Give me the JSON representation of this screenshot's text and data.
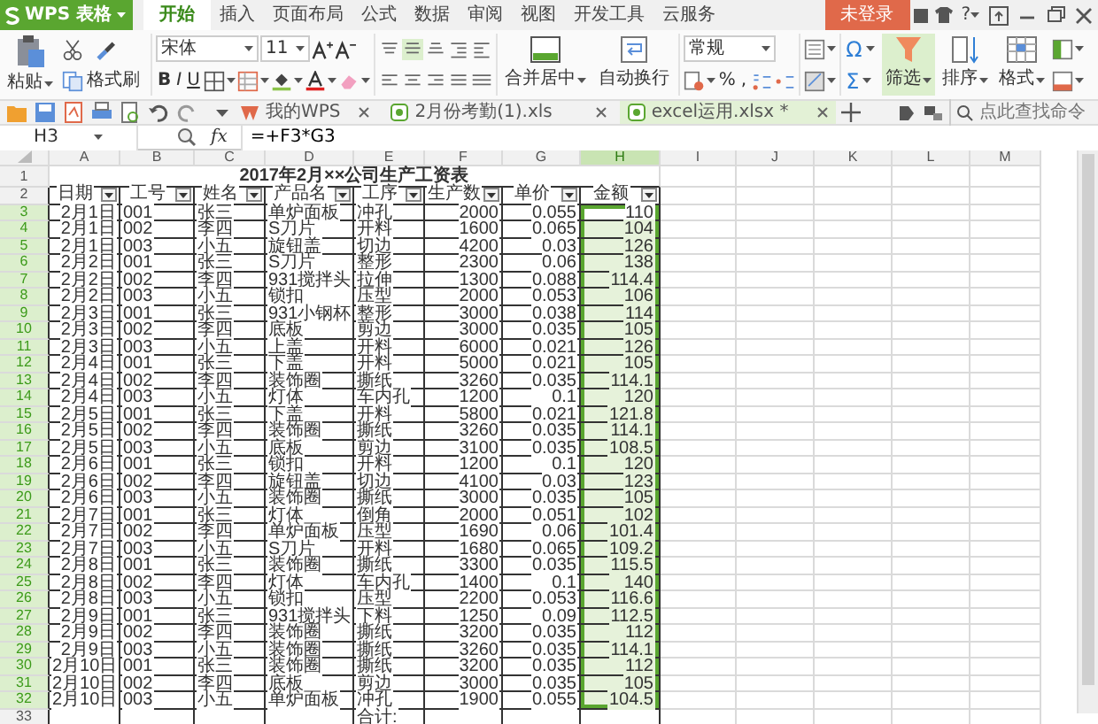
{
  "app_menu": {
    "label": "WPS 表格"
  },
  "menu_tabs": [
    {
      "label": "开始",
      "selected": true
    },
    {
      "label": "插入",
      "selected": false
    },
    {
      "label": "页面布局",
      "selected": false
    },
    {
      "label": "公式",
      "selected": false
    },
    {
      "label": "数据",
      "selected": false
    },
    {
      "label": "审阅",
      "selected": false
    },
    {
      "label": "视图",
      "selected": false
    },
    {
      "label": "开发工具",
      "selected": false
    },
    {
      "label": "云服务",
      "selected": false
    }
  ],
  "login_button": "未登录",
  "help": "?",
  "ribbon": {
    "paste": "粘贴",
    "format_painter": "格式刷",
    "font": "宋体",
    "font_size": "11",
    "bold": "B",
    "italic": "I",
    "underline": "U",
    "merge": "合并居中",
    "wrap": "自动换行",
    "number_format": "常规",
    "percent": "%",
    "thousands": ",",
    "omega": "Ω",
    "sigma": "Σ",
    "filter": "筛选",
    "filter_on": true,
    "sort": "排序",
    "format": "格式"
  },
  "doc_tabs": [
    {
      "label": "我的WPS",
      "selected": false
    },
    {
      "label": "2月份考勤(1).xls",
      "selected": false
    },
    {
      "label": "excel运用.xlsx *",
      "selected": true
    }
  ],
  "command_search": {
    "placeholder": "点此查找命令"
  },
  "name_box": "H3",
  "fx": "fx",
  "formula": "=+F3*G3",
  "columns": [
    {
      "label": "A",
      "selected": false
    },
    {
      "label": "B",
      "selected": false
    },
    {
      "label": "C",
      "selected": false
    },
    {
      "label": "D",
      "selected": false
    },
    {
      "label": "E",
      "selected": false
    },
    {
      "label": "F",
      "selected": false
    },
    {
      "label": "G",
      "selected": false
    },
    {
      "label": "H",
      "selected": true
    },
    {
      "label": "I",
      "selected": false
    },
    {
      "label": "J",
      "selected": false
    },
    {
      "label": "K",
      "selected": false
    },
    {
      "label": "L",
      "selected": false
    },
    {
      "label": "M",
      "selected": false
    }
  ],
  "rows": [
    {
      "number": "1",
      "selected": false,
      "kind": "title",
      "title": "2017年2月××公司生产工资表"
    },
    {
      "number": "2",
      "selected": false,
      "kind": "header",
      "cells": [
        "日期",
        "工号",
        "姓名",
        "产品名",
        "工序",
        "生产数",
        "单价",
        "金额"
      ]
    },
    {
      "number": "3",
      "selected": true,
      "kind": "data",
      "cells": [
        "2月1日",
        "001",
        "张三",
        "单炉面板",
        "冲孔",
        "2000",
        "0.055",
        "110"
      ]
    },
    {
      "number": "4",
      "selected": true,
      "kind": "data",
      "cells": [
        "2月1日",
        "002",
        "李四",
        "S刀片",
        "开料",
        "1600",
        "0.065",
        "104"
      ]
    },
    {
      "number": "5",
      "selected": true,
      "kind": "data",
      "cells": [
        "2月1日",
        "003",
        "小五",
        "旋钮盖",
        "切边",
        "4200",
        "0.03",
        "126"
      ]
    },
    {
      "number": "6",
      "selected": true,
      "kind": "data",
      "cells": [
        "2月2日",
        "001",
        "张三",
        "S刀片",
        "整形",
        "2300",
        "0.06",
        "138"
      ]
    },
    {
      "number": "7",
      "selected": true,
      "kind": "data",
      "cells": [
        "2月2日",
        "002",
        "李四",
        "931搅拌头",
        "拉伸",
        "1300",
        "0.088",
        "114.4"
      ]
    },
    {
      "number": "8",
      "selected": true,
      "kind": "data",
      "cells": [
        "2月2日",
        "003",
        "小五",
        "锁扣",
        "压型",
        "2000",
        "0.053",
        "106"
      ]
    },
    {
      "number": "9",
      "selected": true,
      "kind": "data",
      "cells": [
        "2月3日",
        "001",
        "张三",
        "931小钢杯",
        "整形",
        "3000",
        "0.038",
        "114"
      ]
    },
    {
      "number": "10",
      "selected": true,
      "kind": "data",
      "cells": [
        "2月3日",
        "002",
        "李四",
        "底板",
        "剪边",
        "3000",
        "0.035",
        "105"
      ]
    },
    {
      "number": "11",
      "selected": true,
      "kind": "data",
      "cells": [
        "2月3日",
        "003",
        "小五",
        "上盖",
        "开料",
        "6000",
        "0.021",
        "126"
      ]
    },
    {
      "number": "12",
      "selected": true,
      "kind": "data",
      "cells": [
        "2月4日",
        "001",
        "张三",
        "下盖",
        "开料",
        "5000",
        "0.021",
        "105"
      ]
    },
    {
      "number": "13",
      "selected": true,
      "kind": "data",
      "cells": [
        "2月4日",
        "002",
        "李四",
        "装饰圈",
        "撕纸",
        "3260",
        "0.035",
        "114.1"
      ]
    },
    {
      "number": "14",
      "selected": true,
      "kind": "data",
      "cells": [
        "2月4日",
        "003",
        "小五",
        "灯体",
        "车内孔",
        "1200",
        "0.1",
        "120"
      ]
    },
    {
      "number": "15",
      "selected": true,
      "kind": "data",
      "cells": [
        "2月5日",
        "001",
        "张三",
        "下盖",
        "开料",
        "5800",
        "0.021",
        "121.8"
      ]
    },
    {
      "number": "16",
      "selected": true,
      "kind": "data",
      "cells": [
        "2月5日",
        "002",
        "李四",
        "装饰圈",
        "撕纸",
        "3260",
        "0.035",
        "114.1"
      ]
    },
    {
      "number": "17",
      "selected": true,
      "kind": "data",
      "cells": [
        "2月5日",
        "003",
        "小五",
        "底板",
        "剪边",
        "3100",
        "0.035",
        "108.5"
      ]
    },
    {
      "number": "18",
      "selected": true,
      "kind": "data",
      "cells": [
        "2月6日",
        "001",
        "张三",
        "锁扣",
        "开料",
        "1200",
        "0.1",
        "120"
      ]
    },
    {
      "number": "19",
      "selected": true,
      "kind": "data",
      "cells": [
        "2月6日",
        "002",
        "李四",
        "旋钮盖",
        "切边",
        "4100",
        "0.03",
        "123"
      ]
    },
    {
      "number": "20",
      "selected": true,
      "kind": "data",
      "cells": [
        "2月6日",
        "003",
        "小五",
        "装饰圈",
        "撕纸",
        "3000",
        "0.035",
        "105"
      ]
    },
    {
      "number": "21",
      "selected": true,
      "kind": "data",
      "cells": [
        "2月7日",
        "001",
        "张三",
        "灯体",
        "倒角",
        "2000",
        "0.051",
        "102"
      ]
    },
    {
      "number": "22",
      "selected": true,
      "kind": "data",
      "cells": [
        "2月7日",
        "002",
        "李四",
        "单炉面板",
        "压型",
        "1690",
        "0.06",
        "101.4"
      ]
    },
    {
      "number": "23",
      "selected": true,
      "kind": "data",
      "cells": [
        "2月7日",
        "003",
        "小五",
        "S刀片",
        "开料",
        "1680",
        "0.065",
        "109.2"
      ]
    },
    {
      "number": "24",
      "selected": true,
      "kind": "data",
      "cells": [
        "2月8日",
        "001",
        "张三",
        "装饰圈",
        "撕纸",
        "3300",
        "0.035",
        "115.5"
      ]
    },
    {
      "number": "25",
      "selected": true,
      "kind": "data",
      "cells": [
        "2月8日",
        "002",
        "李四",
        "灯体",
        "车内孔",
        "1400",
        "0.1",
        "140"
      ]
    },
    {
      "number": "26",
      "selected": true,
      "kind": "data",
      "cells": [
        "2月8日",
        "003",
        "小五",
        "锁扣",
        "压型",
        "2200",
        "0.053",
        "116.6"
      ]
    },
    {
      "number": "27",
      "selected": true,
      "kind": "data",
      "cells": [
        "2月9日",
        "001",
        "张三",
        "931搅拌头",
        "下料",
        "1250",
        "0.09",
        "112.5"
      ]
    },
    {
      "number": "28",
      "selected": true,
      "kind": "data",
      "cells": [
        "2月9日",
        "002",
        "李四",
        "装饰圈",
        "撕纸",
        "3200",
        "0.035",
        "112"
      ]
    },
    {
      "number": "29",
      "selected": true,
      "kind": "data",
      "cells": [
        "2月9日",
        "003",
        "小五",
        "装饰圈",
        "撕纸",
        "3260",
        "0.035",
        "114.1"
      ]
    },
    {
      "number": "30",
      "selected": true,
      "kind": "data",
      "cells": [
        "2月10日",
        "001",
        "张三",
        "装饰圈",
        "撕纸",
        "3200",
        "0.035",
        "112"
      ]
    },
    {
      "number": "31",
      "selected": true,
      "kind": "data",
      "cells": [
        "2月10日",
        "002",
        "李四",
        "底板",
        "剪边",
        "3000",
        "0.035",
        "105"
      ]
    },
    {
      "number": "32",
      "selected": true,
      "kind": "data",
      "cells": [
        "2月10日",
        "003",
        "小五",
        "单炉面板",
        "冲孔",
        "1900",
        "0.055",
        "104.5"
      ]
    },
    {
      "number": "33",
      "selected": false,
      "kind": "total",
      "cells": [
        null,
        null,
        null,
        null,
        "合计:",
        null,
        null,
        null
      ]
    }
  ]
}
